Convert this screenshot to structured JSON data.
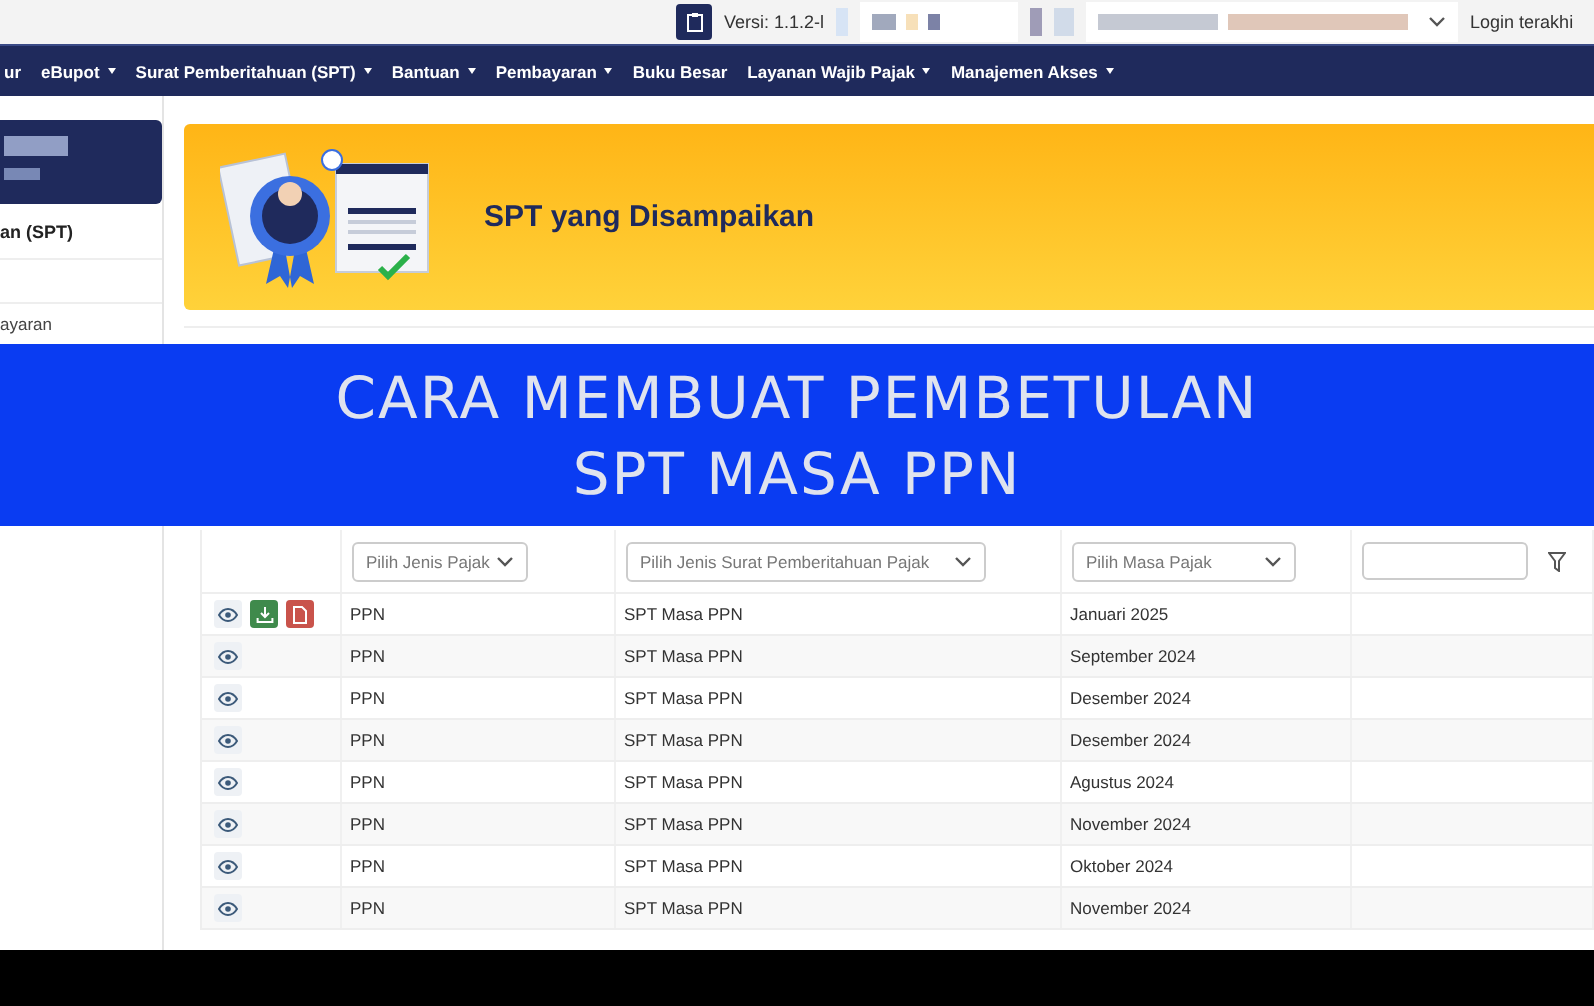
{
  "top_bar": {
    "version": "Versi:  1.1.2-l",
    "last_login": "Login terakhi"
  },
  "nav": [
    {
      "label": "ur",
      "has_menu": false
    },
    {
      "label": "eBupot",
      "has_menu": true
    },
    {
      "label": "Surat Pemberitahuan (SPT)",
      "has_menu": true
    },
    {
      "label": "Bantuan",
      "has_menu": true
    },
    {
      "label": "Pembayaran",
      "has_menu": true
    },
    {
      "label": "Buku Besar",
      "has_menu": false
    },
    {
      "label": "Layanan Wajib Pajak",
      "has_menu": true
    },
    {
      "label": "Manajemen Akses",
      "has_menu": true
    }
  ],
  "sidebar": {
    "heading": "an (SPT)",
    "items": [
      "ayaran"
    ]
  },
  "page_header": {
    "title": "SPT yang Disampaikan"
  },
  "overlay": {
    "lines": [
      "CARA MEMBUAT PEMBETULAN",
      "SPT MASA PPN"
    ]
  },
  "filters": [
    {
      "kind": "select",
      "placeholder": "Pilih Jenis Pajak"
    },
    {
      "kind": "select",
      "placeholder": "Pilih Jenis Surat Pemberitahuan Pajak"
    },
    {
      "kind": "select",
      "placeholder": "Pilih Masa Pajak"
    },
    {
      "kind": "text"
    }
  ],
  "rows": [
    {
      "actions": [
        {
          "kind": "view"
        },
        {
          "kind": "download"
        },
        {
          "kind": "pdf"
        }
      ],
      "tax": "PPN",
      "spt": "SPT Masa PPN",
      "period": "Januari 2025"
    },
    {
      "actions": [
        {
          "kind": "view"
        }
      ],
      "tax": "PPN",
      "spt": "SPT Masa PPN",
      "period": "September 2024"
    },
    {
      "actions": [
        {
          "kind": "view"
        }
      ],
      "tax": "PPN",
      "spt": "SPT Masa PPN",
      "period": "Desember 2024"
    },
    {
      "actions": [
        {
          "kind": "view"
        }
      ],
      "tax": "PPN",
      "spt": "SPT Masa PPN",
      "period": "Desember 2024"
    },
    {
      "actions": [
        {
          "kind": "view"
        }
      ],
      "tax": "PPN",
      "spt": "SPT Masa PPN",
      "period": "Agustus 2024"
    },
    {
      "actions": [
        {
          "kind": "view"
        }
      ],
      "tax": "PPN",
      "spt": "SPT Masa PPN",
      "period": "November 2024"
    },
    {
      "actions": [
        {
          "kind": "view"
        }
      ],
      "tax": "PPN",
      "spt": "SPT Masa PPN",
      "period": "Oktober 2024"
    },
    {
      "actions": [
        {
          "kind": "view"
        }
      ],
      "tax": "PPN",
      "spt": "SPT Masa PPN",
      "period": "November 2024"
    }
  ]
}
